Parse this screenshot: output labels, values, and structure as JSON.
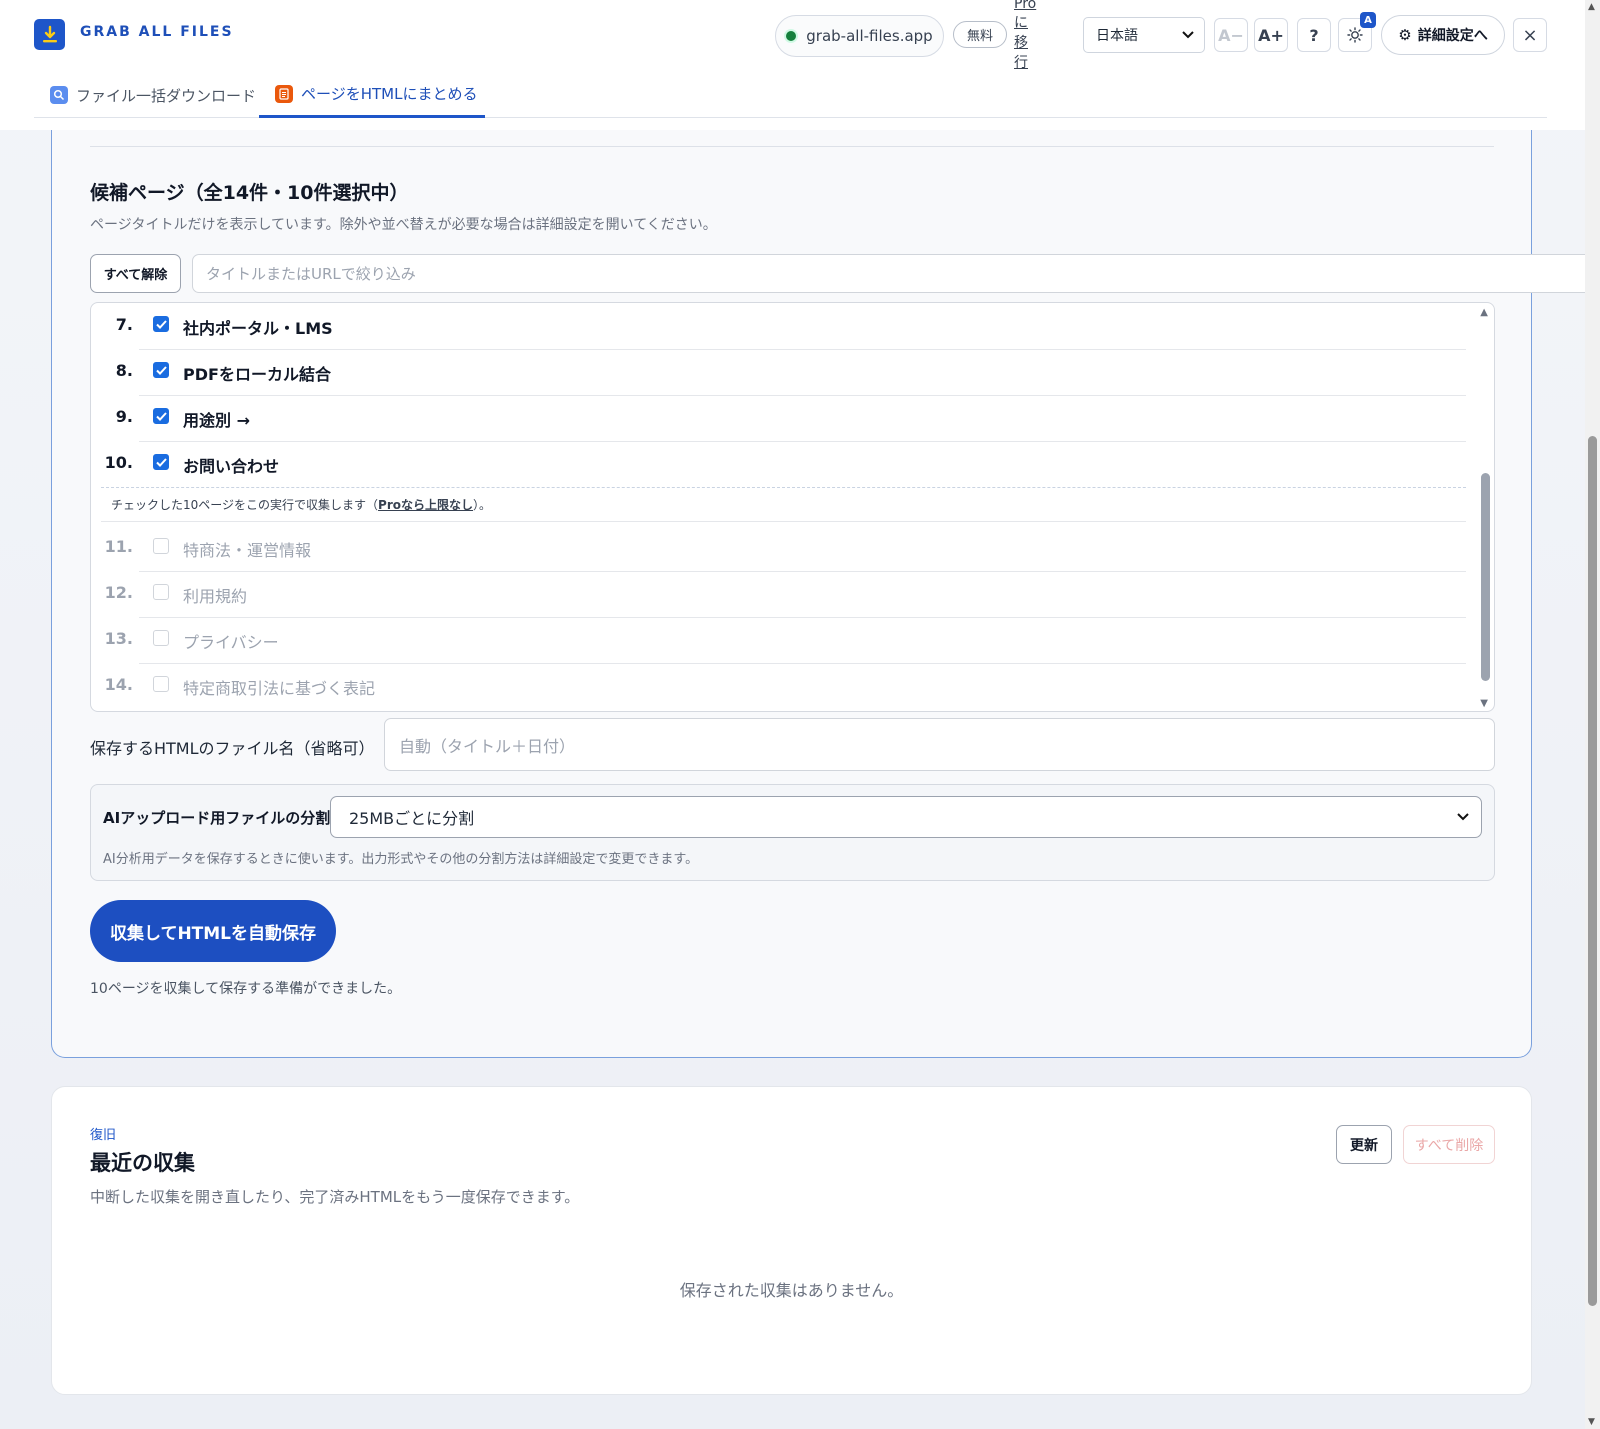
{
  "app": {
    "title": "GRAB ALL FILES"
  },
  "toolbar": {
    "domain": "grab-all-files.app",
    "plan": "無料",
    "pro_link": "Proに移行",
    "language": "日本語",
    "font_decrease": "A−",
    "font_increase": "A+",
    "help": "?",
    "theme_badge": "A",
    "settings": "詳細設定へ",
    "close": "×"
  },
  "tabs": [
    {
      "label": "ファイル一括ダウンロード"
    },
    {
      "label": "ページをHTMLにまとめる"
    }
  ],
  "candidates": {
    "title": "候補ページ（全14件・10件選択中）",
    "description": "ページタイトルだけを表示しています。除外や並べ替えが必要な場合は詳細設定を開いてください。",
    "clear_all": "すべて解除",
    "filter_placeholder": "タイトルまたはURLで絞り込み",
    "items": [
      {
        "num": "7.",
        "label": "社内ポータル・LMS",
        "checked": true
      },
      {
        "num": "8.",
        "label": "PDFをローカル結合",
        "checked": true
      },
      {
        "num": "9.",
        "label": "用途別 →",
        "checked": true
      },
      {
        "num": "10.",
        "label": "お問い合わせ",
        "checked": true
      },
      {
        "num": "11.",
        "label": "特商法・運営情報",
        "checked": false
      },
      {
        "num": "12.",
        "label": "利用規約",
        "checked": false
      },
      {
        "num": "13.",
        "label": "プライバシー",
        "checked": false
      },
      {
        "num": "14.",
        "label": "特定商取引法に基づく表記",
        "checked": false
      }
    ],
    "limit_note_prefix": "チェックした10ページをこの実行で収集します（",
    "limit_note_link": "Proなら上限なし",
    "limit_note_suffix": "）。"
  },
  "filename": {
    "label": "保存するHTMLのファイル名（省略可）",
    "placeholder": "自動（タイトル＋日付）"
  },
  "split": {
    "label": "AIアップロード用ファイルの分割",
    "selected": "25MBごとに分割",
    "description": "AI分析用データを保存するときに使います。出力形式やその他の分割方法は詳細設定で変更できます。"
  },
  "action": {
    "button": "収集してHTMLを自動保存",
    "status": "10ページを収集して保存する準備ができました。"
  },
  "recent": {
    "kicker": "復旧",
    "title": "最近の収集",
    "description": "中断した収集を開き直したり、完了済みHTMLをもう一度保存できます。",
    "refresh": "更新",
    "delete_all": "すべて削除",
    "empty": "保存された収集はありません。"
  },
  "colors": {
    "accent": "#1e56c9",
    "checkbox": "#1a6ce0",
    "online": "#15803d"
  }
}
